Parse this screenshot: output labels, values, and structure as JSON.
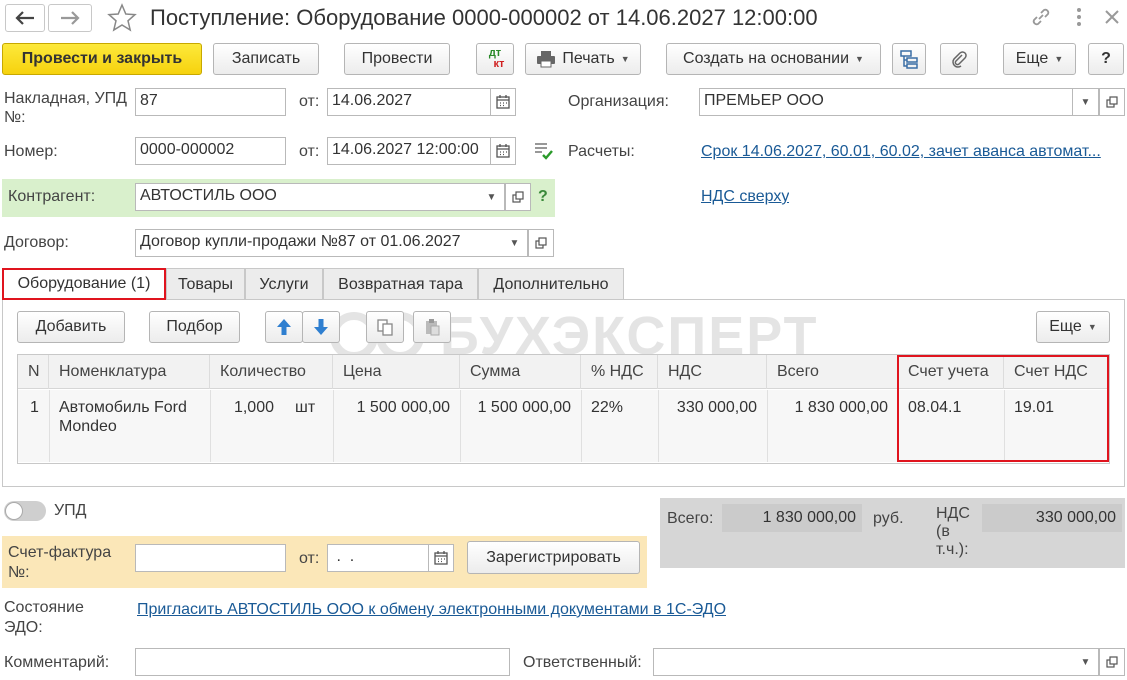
{
  "window": {
    "title": "Поступление: Оборудование 0000-000002 от 14.06.2027 12:00:00"
  },
  "toolbar": {
    "post_close": "Провести и закрыть",
    "save": "Записать",
    "post": "Провести",
    "dtkt_top": "дт",
    "dtkt_bottom": "кт",
    "print": "Печать",
    "create_based": "Создать на основании",
    "more": "Еще",
    "help": "?"
  },
  "header": {
    "invoice_label": "Накладная, УПД №:",
    "invoice_value": "87",
    "from_label": "от:",
    "invoice_date": "14.06.2027",
    "org_label": "Организация:",
    "org_value": "ПРЕМЬЕР ООО",
    "number_label": "Номер:",
    "number_value": "0000-000002",
    "number_date": "14.06.2027 12:00:00",
    "settlements_label": "Расчеты:",
    "settlements_link": "Срок 14.06.2027, 60.01, 60.02, зачет аванса автомат...",
    "contractor_label": "Контрагент:",
    "contractor_value": "АВТОСТИЛЬ ООО",
    "vat_link": "НДС сверху",
    "contract_label": "Договор:",
    "contract_value": "Договор купли-продажи №87 от 01.06.2027"
  },
  "tabs": [
    {
      "label": "Оборудование (1)"
    },
    {
      "label": "Товары"
    },
    {
      "label": "Услуги"
    },
    {
      "label": "Возвратная тара"
    },
    {
      "label": "Дополнительно"
    }
  ],
  "table_toolbar": {
    "add": "Добавить",
    "select": "Подбор",
    "more": "Еще"
  },
  "watermark": "БУХЭКСПЕРТ",
  "table": {
    "columns": [
      "N",
      "Номенклатура",
      "Количество",
      "Цена",
      "Сумма",
      "% НДС",
      "НДС",
      "Всего",
      "Счет учета",
      "Счет НДС"
    ],
    "rows": [
      {
        "n": "1",
        "item_line1": "Автомобиль Ford",
        "item_line2": "Mondeo",
        "qty": "1,000",
        "unit": "шт",
        "price": "1 500 000,00",
        "sum": "1 500 000,00",
        "vat_rate": "22%",
        "vat": "330 000,00",
        "total": "1 830 000,00",
        "account": "08.04.1",
        "vat_account": "19.01"
      }
    ]
  },
  "footer": {
    "upd_label": "УПД",
    "invoice_label_1": "Счет-фактура",
    "invoice_label_2": "№:",
    "from_label": "от:",
    "invoice_date": " .  .",
    "register": "Зарегистрировать",
    "total_label": "Всего:",
    "total_value": "1 830 000,00",
    "currency": "руб.",
    "vat_label_1": "НДС",
    "vat_label_2": "(в",
    "vat_label_3": "т.ч.):",
    "vat_value": "330 000,00",
    "edo_label_1": "Состояние",
    "edo_label_2": "ЭДО:",
    "edo_link": "Пригласить АВТОСТИЛЬ ООО к обмену электронными документами в 1С-ЭДО",
    "comment_label": "Комментарий:",
    "responsible_label": "Ответственный:"
  },
  "colors": {
    "primary_button": "#f6d20e",
    "highlight_red": "#e0141e",
    "contractor_bg": "#d9f0cc",
    "invoice_bg": "#fbe7b8",
    "totals_bg": "#d6d6d6",
    "link": "#1a5a96"
  }
}
